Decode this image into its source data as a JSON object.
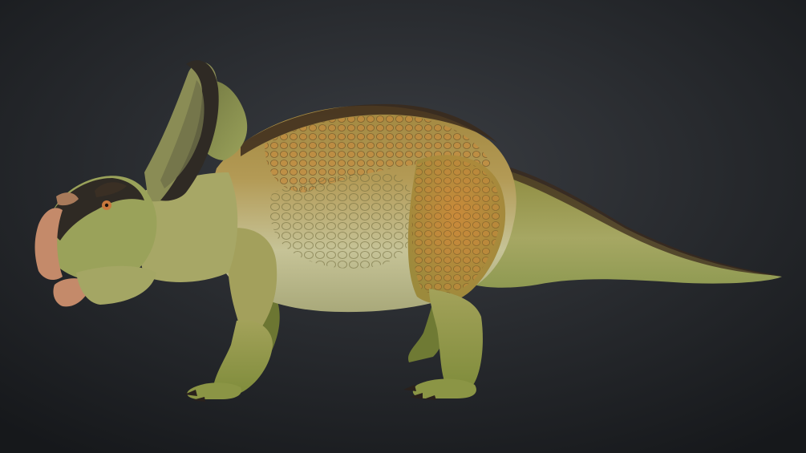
{
  "scene": {
    "subject_icon": "dinosaur-render",
    "background": {
      "center": "#3a3d42",
      "edge": "#16181b"
    },
    "palette": {
      "skin_light": "#c9c79a",
      "skin_mid": "#9aa25a",
      "skin_dark": "#6f7a34",
      "scale_orange": "#b87a2a",
      "ridge_dark": "#3b2a1c",
      "beak": "#c48a6a",
      "frill_dark": "#2f2a24",
      "claw": "#2a211c"
    }
  }
}
